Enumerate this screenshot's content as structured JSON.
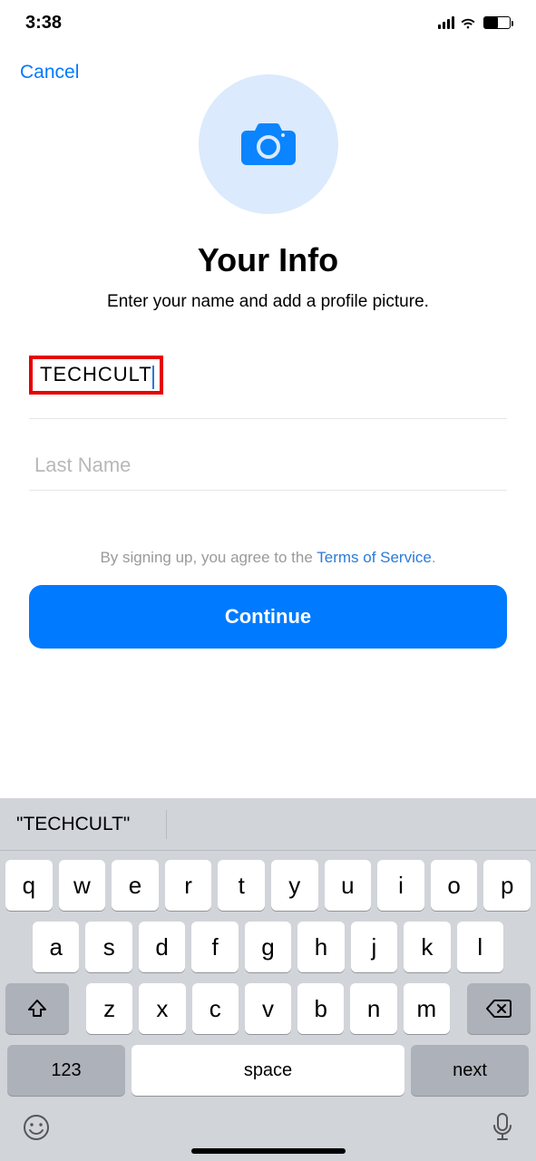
{
  "status": {
    "time": "3:38"
  },
  "header": {
    "cancel_label": "Cancel"
  },
  "profile": {
    "title": "Your Info",
    "subtitle": "Enter your name and add a profile picture.",
    "first_name_value": "TECHCULT",
    "last_name_value": "",
    "last_name_placeholder": "Last Name"
  },
  "tos": {
    "prefix": "By signing up, you agree to the ",
    "link": "Terms of Service",
    "suffix": "."
  },
  "cta": {
    "continue_label": "Continue"
  },
  "keyboard": {
    "suggestion": "\"TECHCULT\"",
    "row1": [
      "q",
      "w",
      "e",
      "r",
      "t",
      "y",
      "u",
      "i",
      "o",
      "p"
    ],
    "row2": [
      "a",
      "s",
      "d",
      "f",
      "g",
      "h",
      "j",
      "k",
      "l"
    ],
    "row3": [
      "z",
      "x",
      "c",
      "v",
      "b",
      "n",
      "m"
    ],
    "k123": "123",
    "space": "space",
    "next": "next"
  }
}
